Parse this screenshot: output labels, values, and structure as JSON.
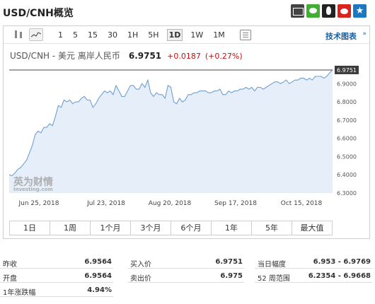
{
  "page": {
    "title": "USD/CNH概览"
  },
  "share_icons": [
    "mail-icon",
    "wechat-icon",
    "qq-icon",
    "weibo-icon",
    "favorite-icon"
  ],
  "toolbar": {
    "periods": [
      "1",
      "5",
      "15",
      "30",
      "1H",
      "5H",
      "1D",
      "1W",
      "1M"
    ],
    "active_period": "1D",
    "tech_link": "技术图表",
    "tech_arrow": "»"
  },
  "quote": {
    "name": "USD/CNH - 美元 离岸人民币",
    "price": "6.9751",
    "change": "+0.0187",
    "change_pct": "(+0.27%)"
  },
  "watermark": {
    "top": "英为财情",
    "bottom": "Investing.com"
  },
  "range_buttons": [
    "1日",
    "1周",
    "1个月",
    "3个月",
    "6个月",
    "1年",
    "5年",
    "最大值"
  ],
  "stats": {
    "prev_close": {
      "label": "昨收",
      "value": "6.9564"
    },
    "open": {
      "label": "开盘",
      "value": "6.9564"
    },
    "year_change": {
      "label": "1年涨跌幅",
      "value": "4.94%"
    },
    "bid": {
      "label": "买入价",
      "value": "6.9751"
    },
    "ask": {
      "label": "卖出价",
      "value": "6.975"
    },
    "day_range": {
      "label": "当日幅度",
      "value": "6.953 - 6.9769"
    },
    "week52_range": {
      "label": "52 周范围",
      "value": "6.2354 - 6.9668"
    }
  },
  "colors": {
    "line": "#6f9fd3",
    "area": "#e5eef9",
    "up": "#d10b0b",
    "last_price_bg": "#3c3c3c"
  },
  "chart_data": {
    "type": "area",
    "x_labels": [
      "Jun 25, 2018",
      "Jul 23, 2018",
      "Aug 20, 2018",
      "Sep 17, 2018",
      "Oct 15, 2018"
    ],
    "y_ticks": [
      "6.3000",
      "6.4000",
      "6.5000",
      "6.6000",
      "6.7000",
      "6.8000",
      "6.9000"
    ],
    "ylim": [
      6.3,
      6.975
    ],
    "last_price_label": "6.9751",
    "series": [
      {
        "values": [
          6.4,
          6.395,
          6.41,
          6.43,
          6.44,
          6.46,
          6.48,
          6.52,
          6.56,
          6.62,
          6.64,
          6.63,
          6.66,
          6.66,
          6.68,
          6.67,
          6.72,
          6.78,
          6.77,
          6.81,
          6.8,
          6.81,
          6.79,
          6.8,
          6.8,
          6.82,
          6.83,
          6.81,
          6.81,
          6.77,
          6.79,
          6.82,
          6.84,
          6.86,
          6.85,
          6.86,
          6.84,
          6.89,
          6.86,
          6.83,
          6.83,
          6.86,
          6.89,
          6.89,
          6.87,
          6.87,
          6.9,
          6.88,
          6.92,
          6.85,
          6.83,
          6.85,
          6.84,
          6.84,
          6.82,
          6.89,
          6.88,
          6.8,
          6.79,
          6.82,
          6.8,
          6.81,
          6.84,
          6.84,
          6.85,
          6.85,
          6.86,
          6.86,
          6.86,
          6.85,
          6.85,
          6.86,
          6.86,
          6.87,
          6.84,
          6.84,
          6.86,
          6.85,
          6.86,
          6.86,
          6.87,
          6.87,
          6.88,
          6.87,
          6.88,
          6.86,
          6.88,
          6.88,
          6.87,
          6.88,
          6.89,
          6.9,
          6.91,
          6.91,
          6.9,
          6.91,
          6.92,
          6.9,
          6.91,
          6.92,
          6.92,
          6.93,
          6.93,
          6.92,
          6.93,
          6.92,
          6.94,
          6.94,
          6.94,
          6.93,
          6.94,
          6.96,
          6.9751
        ]
      }
    ]
  }
}
